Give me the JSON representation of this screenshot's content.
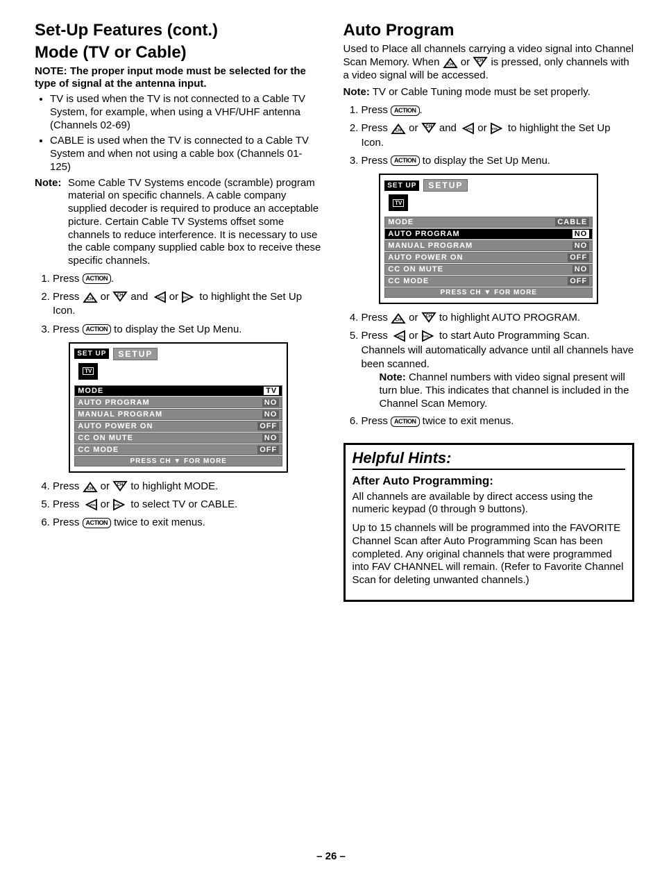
{
  "page_number": "– 26 –",
  "left": {
    "heading1": "Set-Up Features (cont.)",
    "heading2": "Mode (TV or Cable)",
    "note": "NOTE: The proper input mode must be selected for the type of signal at the antenna input.",
    "bullets": [
      "TV is used when the TV is not connected to a Cable TV System, for example, when using a VHF/UHF antenna (Channels 02-69)",
      "CABLE is used when the TV is connected to a Cable TV System and when not using a cable box (Channels 01-125)"
    ],
    "note2_label": "Note:",
    "note2_text": "Some Cable TV Systems encode (scramble) program material on specific channels. A cable company supplied decoder is required to produce an acceptable picture. Certain Cable TV Systems offset some channels to reduce interference. It is necessary to use the cable company supplied cable box to receive these specific channels.",
    "step1_a": "Press ",
    "step1_b": ".",
    "step2_a": "Press ",
    "step2_b": " or ",
    "step2_c": " and ",
    "step2_d": " or ",
    "step2_e": " to highlight the Set Up Icon.",
    "step3_a": "Press ",
    "step3_b": " to display the Set Up Menu.",
    "step4_a": "Press ",
    "step4_b": " or ",
    "step4_c": " to highlight MODE.",
    "step5_a": "Press ",
    "step5_b": " or ",
    "step5_c": " to select TV or CABLE.",
    "step6_a": "Press ",
    "step6_b": " twice to exit menus.",
    "menu": {
      "badge": "SET UP",
      "label": "SETUP",
      "tv": "TV",
      "rows": [
        {
          "k": "MODE",
          "v": "TV",
          "hl": true
        },
        {
          "k": "AUTO PROGRAM",
          "v": "NO"
        },
        {
          "k": "MANUAL PROGRAM",
          "v": "NO"
        },
        {
          "k": "AUTO POWER ON",
          "v": "OFF"
        },
        {
          "k": "CC ON MUTE",
          "v": "NO"
        },
        {
          "k": "CC MODE",
          "v": "OFF"
        }
      ],
      "footer": "PRESS CH ▼ FOR MORE"
    }
  },
  "right": {
    "heading": "Auto Program",
    "intro_a": "Used to Place all channels carrying a video signal into Channel Scan Memory. When ",
    "intro_b": " or ",
    "intro_c": " is pressed, only channels with a video signal will be accessed.",
    "note1": "Note: TV or Cable Tuning mode must be set properly.",
    "step1_a": "Press ",
    "step1_b": ".",
    "step2_a": "Press ",
    "step2_b": " or ",
    "step2_c": " and ",
    "step2_d": " or ",
    "step2_e": " to highlight the Set Up Icon.",
    "step3_a": "Press ",
    "step3_b": " to display the Set Up Menu.",
    "step4_a": "Press ",
    "step4_b": " or ",
    "step4_c": " to highlight AUTO PROGRAM.",
    "step5_a": "Press ",
    "step5_b": " or ",
    "step5_c": " to start Auto Programming Scan. Channels will automatically advance until all channels have been scanned.",
    "step5_note_label": "Note:",
    "step5_note": " Channel numbers with video signal present will turn blue. This indicates that channel is included in the Channel Scan Memory.",
    "step6_a": "Press ",
    "step6_b": " twice to exit menus.",
    "menu": {
      "badge": "SET UP",
      "label": "SETUP",
      "tv": "TV",
      "rows": [
        {
          "k": "MODE",
          "v": "CABLE"
        },
        {
          "k": "AUTO PROGRAM",
          "v": "NO",
          "hl": true
        },
        {
          "k": "MANUAL PROGRAM",
          "v": "NO"
        },
        {
          "k": "AUTO POWER ON",
          "v": "OFF"
        },
        {
          "k": "CC ON MUTE",
          "v": "NO"
        },
        {
          "k": "CC MODE",
          "v": "OFF"
        }
      ],
      "footer": "PRESS CH ▼ FOR MORE"
    },
    "hints": {
      "title": "Helpful Hints:",
      "sub": "After Auto Programming:",
      "p1": "All channels are available by direct access using the numeric keypad (0 through 9 buttons).",
      "p2": "Up to 15 channels will be programmed into the FAVORITE Channel Scan after Auto Programming Scan has been completed. Any original channels that were programmed into FAV CHANNEL will remain. (Refer to Favorite Channel Scan for deleting unwanted channels.)"
    }
  },
  "icons": {
    "action": "ACTION",
    "up_ch": "CH",
    "down_ch": "CH",
    "left_vol": "VOL",
    "right_vol": "VOL"
  }
}
